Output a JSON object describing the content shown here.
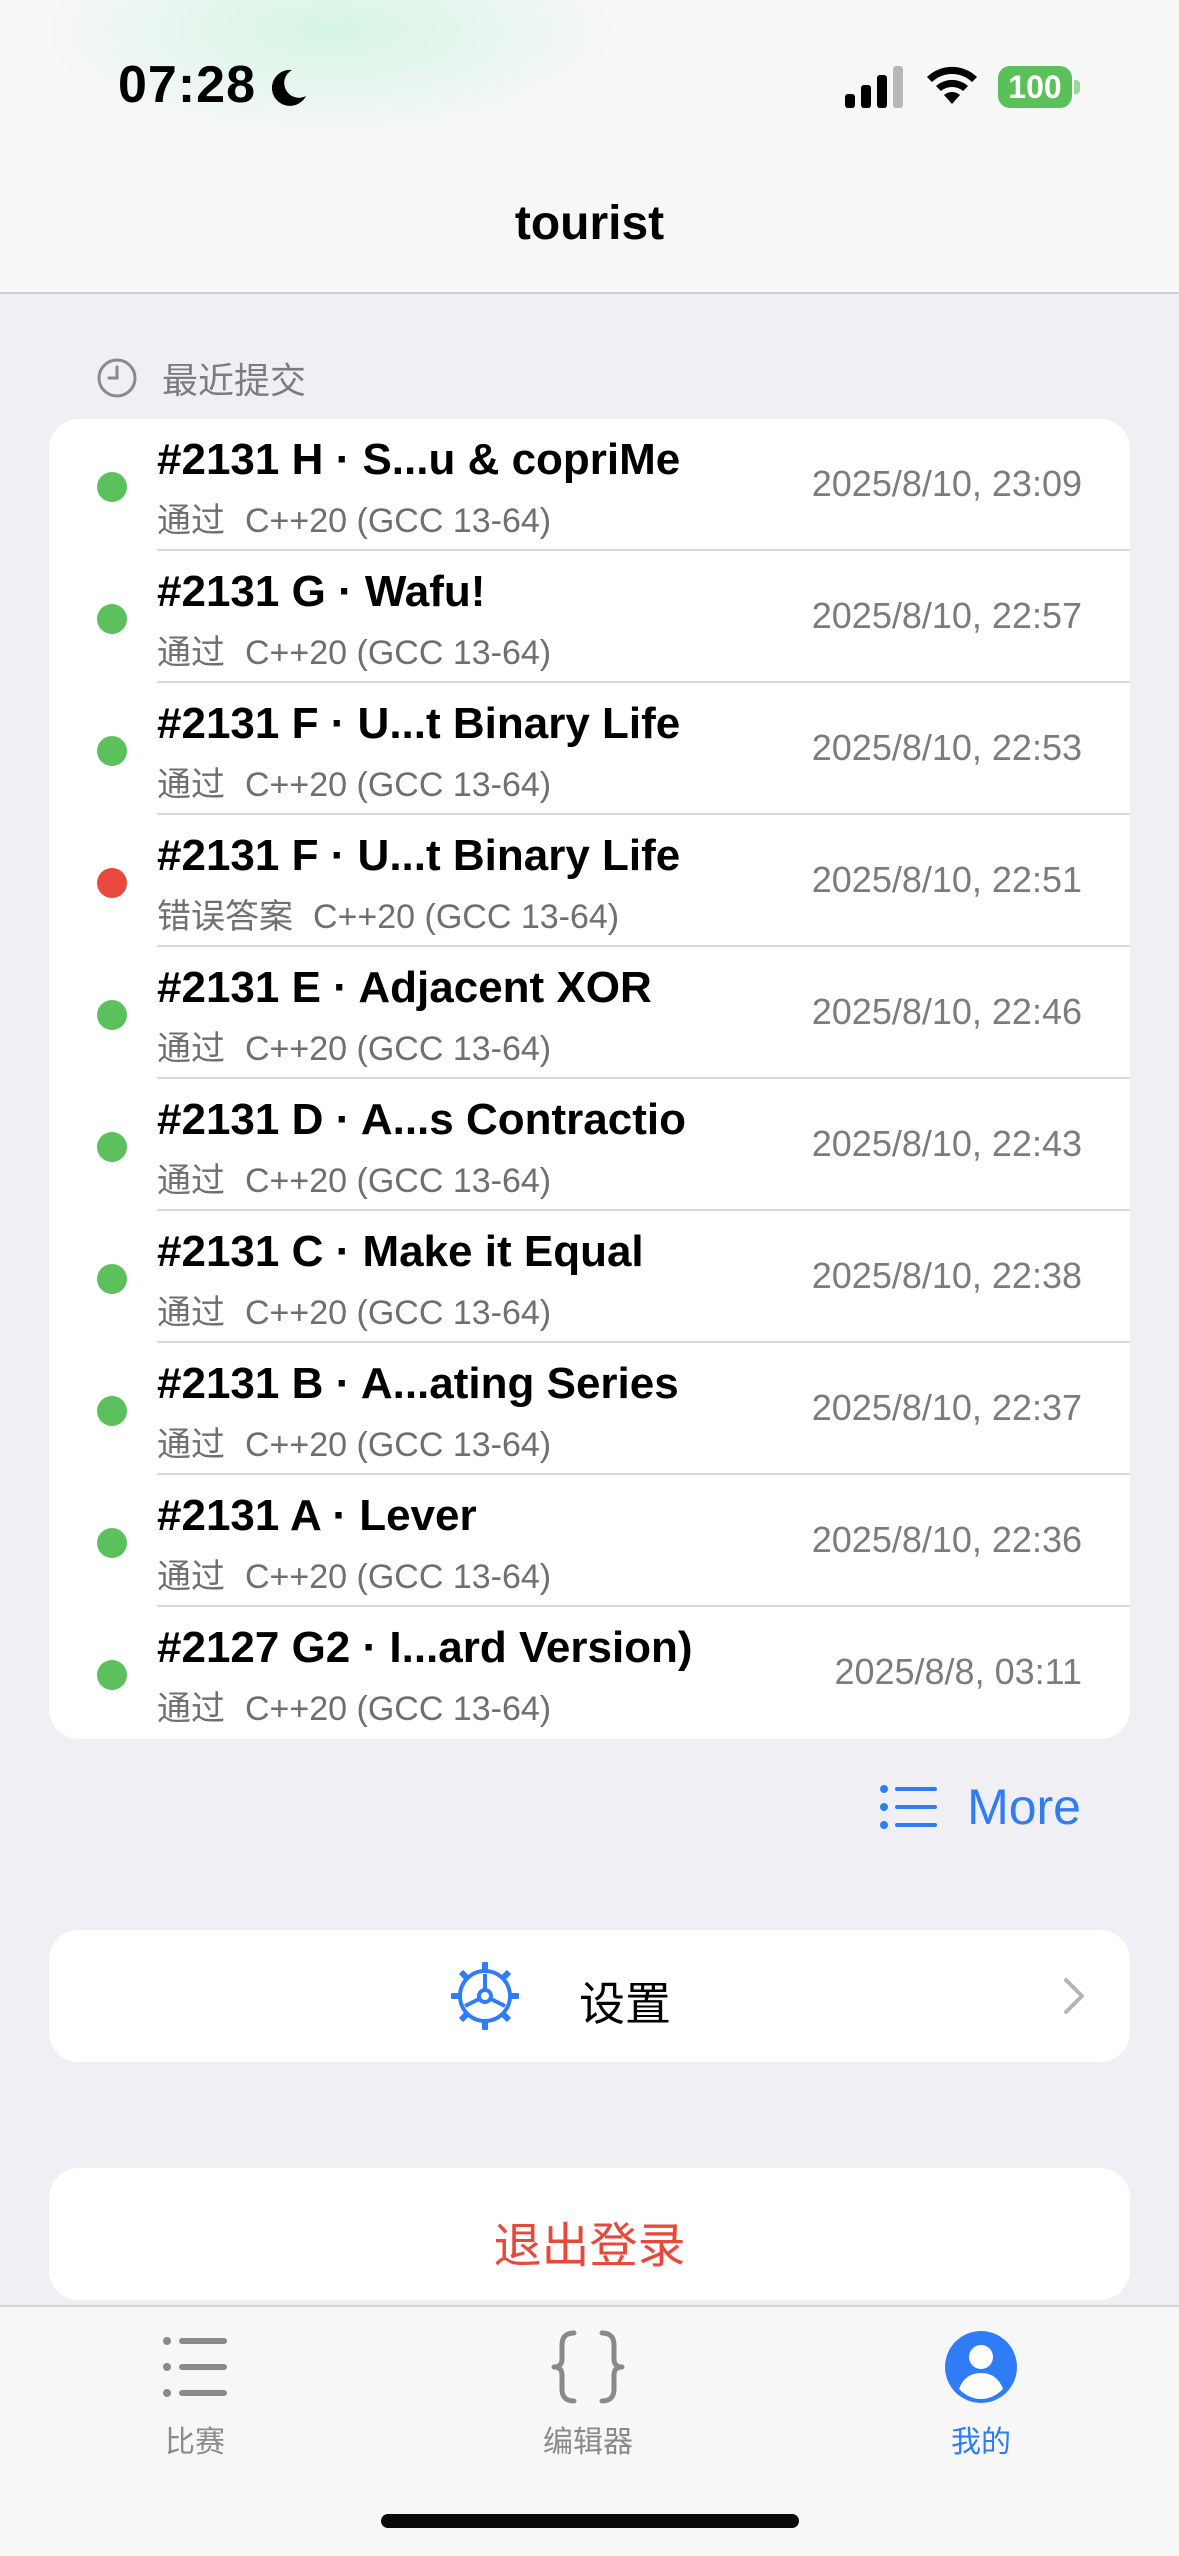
{
  "status_bar": {
    "time": "07:28",
    "battery": "100",
    "icons": [
      "moon-icon",
      "cellular-signal-icon",
      "wifi-icon",
      "battery-icon"
    ]
  },
  "nav": {
    "title": "tourist"
  },
  "recent": {
    "header": "最近提交",
    "items": [
      {
        "title": "#2131 H · S...u & copriMe",
        "verdict": "通过",
        "lang": "C++20 (GCC 13-64)",
        "time": "2025/8/10, 23:09",
        "status": "accepted"
      },
      {
        "title": "#2131 G · Wafu!",
        "verdict": "通过",
        "lang": "C++20 (GCC 13-64)",
        "time": "2025/8/10, 22:57",
        "status": "accepted"
      },
      {
        "title": "#2131 F · U...t Binary Life",
        "verdict": "通过",
        "lang": "C++20 (GCC 13-64)",
        "time": "2025/8/10, 22:53",
        "status": "accepted"
      },
      {
        "title": "#2131 F · U...t Binary Life",
        "verdict": "错误答案",
        "lang": "C++20 (GCC 13-64)",
        "time": "2025/8/10, 22:51",
        "status": "wrong"
      },
      {
        "title": "#2131 E · Adjacent XOR",
        "verdict": "通过",
        "lang": "C++20 (GCC 13-64)",
        "time": "2025/8/10, 22:46",
        "status": "accepted"
      },
      {
        "title": "#2131 D · A...s Contractio",
        "verdict": "通过",
        "lang": "C++20 (GCC 13-64)",
        "time": "2025/8/10, 22:43",
        "status": "accepted"
      },
      {
        "title": "#2131 C · Make it Equal",
        "verdict": "通过",
        "lang": "C++20 (GCC 13-64)",
        "time": "2025/8/10, 22:38",
        "status": "accepted"
      },
      {
        "title": "#2131 B · A...ating Series",
        "verdict": "通过",
        "lang": "C++20 (GCC 13-64)",
        "time": "2025/8/10, 22:37",
        "status": "accepted"
      },
      {
        "title": "#2131 A · Lever",
        "verdict": "通过",
        "lang": "C++20 (GCC 13-64)",
        "time": "2025/8/10, 22:36",
        "status": "accepted"
      },
      {
        "title": "#2127 G2 · I...ard Version)",
        "verdict": "通过",
        "lang": "C++20 (GCC 13-64)",
        "time": "2025/8/8, 03:11",
        "status": "accepted"
      }
    ],
    "more_label": "More"
  },
  "settings": {
    "label": "设置"
  },
  "logout": {
    "label": "退出登录"
  },
  "tabs": [
    {
      "label": "比赛",
      "icon": "list-icon",
      "active": false
    },
    {
      "label": "编辑器",
      "icon": "braces-icon",
      "active": false
    },
    {
      "label": "我的",
      "icon": "person-icon",
      "active": true
    }
  ],
  "colors": {
    "accent": "#2f7df6",
    "accepted": "#5cc15c",
    "wrong": "#e8493c",
    "background": "#f0f0f4"
  }
}
